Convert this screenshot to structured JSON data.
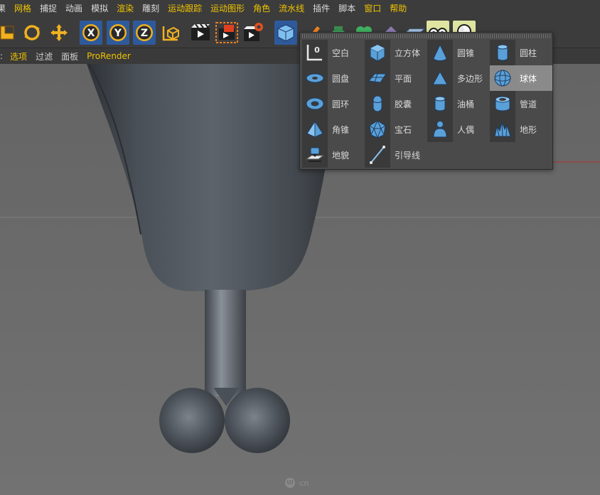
{
  "menu": [
    "果",
    "网格",
    "捕捉",
    "动画",
    "模拟",
    "渲染",
    "雕刻",
    "运动跟踪",
    "运动图形",
    "角色",
    "流水线",
    "插件",
    "脚本",
    "窗口",
    "帮助"
  ],
  "tabs": [
    "选项",
    "过滤",
    "面板",
    "ProRender"
  ],
  "toolbar": {
    "tools": [
      "scale-icon",
      "rotate-icon",
      "move-icon",
      "x-axis-icon",
      "y-axis-icon",
      "z-axis-icon",
      "coordinate-system-icon",
      "render-view-icon",
      "render-region-icon",
      "render-settings-icon",
      "cube-icon",
      "pen-icon",
      "subdivision-icon",
      "mograph-icon",
      "deformer-icon",
      "floor-icon",
      "camera-icon",
      "light-icon"
    ],
    "axis_labels": [
      "X",
      "Y",
      "Z"
    ]
  },
  "popup": {
    "items": [
      {
        "label": "空白",
        "icon": "null-icon"
      },
      {
        "label": "立方体",
        "icon": "cube-icon"
      },
      {
        "label": "圆锥",
        "icon": "cone-icon"
      },
      {
        "label": "圆柱",
        "icon": "cylinder-icon"
      },
      {
        "label": "圆盘",
        "icon": "disc-icon"
      },
      {
        "label": "平面",
        "icon": "plane-icon"
      },
      {
        "label": "多边形",
        "icon": "polygon-icon"
      },
      {
        "label": "球体",
        "icon": "sphere-icon",
        "selected": true
      },
      {
        "label": "圆环",
        "icon": "torus-icon"
      },
      {
        "label": "胶囊",
        "icon": "capsule-icon"
      },
      {
        "label": "油桶",
        "icon": "oil-tank-icon"
      },
      {
        "label": "管道",
        "icon": "tube-icon"
      },
      {
        "label": "角锥",
        "icon": "pyramid-icon"
      },
      {
        "label": "宝石",
        "icon": "platonic-icon"
      },
      {
        "label": "人偶",
        "icon": "figure-icon"
      },
      {
        "label": "地形",
        "icon": "landscape-icon"
      },
      {
        "label": "地貌",
        "icon": "relief-icon"
      },
      {
        "label": "引导线",
        "icon": "guide-icon"
      }
    ]
  },
  "watermark": {
    "logo": "UI",
    "text": "·cn"
  },
  "colors": {
    "accent": "#f0c400",
    "icon_blue": "#5aa0d8",
    "selected_bg": "#8a8a8a"
  }
}
